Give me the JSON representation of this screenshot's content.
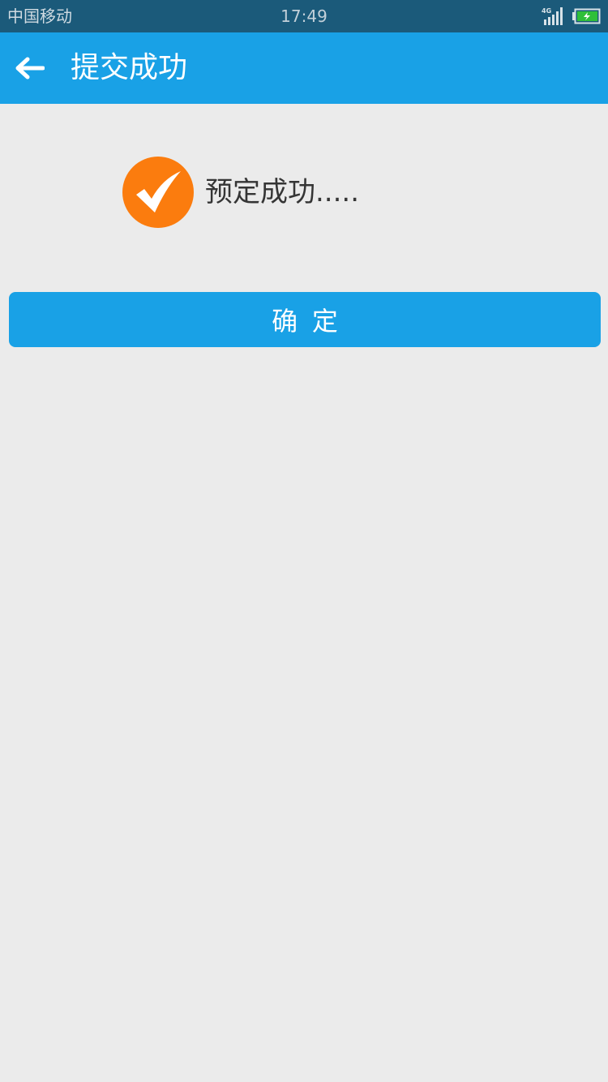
{
  "status_bar": {
    "carrier": "中国移动",
    "time": "17:49",
    "network": "4G",
    "colors": {
      "background": "#1b5a7a",
      "battery_fill": "#2fbf3a"
    }
  },
  "app_bar": {
    "title": "提交成功",
    "back_icon": "arrow-left-icon",
    "background": "#19a1e6"
  },
  "content": {
    "status_icon": "check-circle-icon",
    "status_color": "#fb7c0e",
    "message": "预定成功....."
  },
  "actions": {
    "confirm_label": "确  定",
    "button_color": "#19a1e6"
  },
  "page_background": "#ebebeb"
}
